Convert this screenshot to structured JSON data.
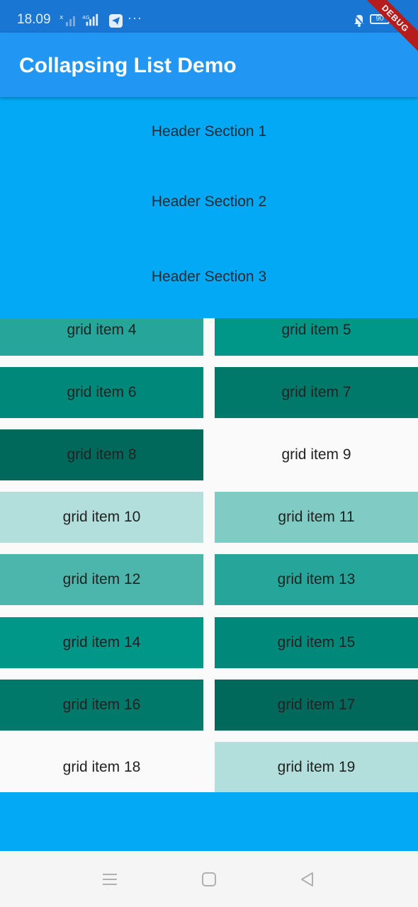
{
  "status_bar": {
    "time": "18.09",
    "battery": "90",
    "more": "···",
    "icons": [
      "signal-x-icon",
      "signal-4g-icon",
      "telegram-icon",
      "bell-off-icon",
      "battery-icon",
      "charging-icon"
    ]
  },
  "debug_banner": "DEBUG",
  "app_bar": {
    "title": "Collapsing List Demo"
  },
  "headers": [
    {
      "label": "Header Section 1"
    },
    {
      "label": "Header Section 2"
    },
    {
      "label": "Header Section 3"
    }
  ],
  "grid": {
    "items": [
      {
        "label": "grid item 4",
        "color": "#26a69a"
      },
      {
        "label": "grid item 5",
        "color": "#009688"
      },
      {
        "label": "grid item 6",
        "color": "#00897b"
      },
      {
        "label": "grid item 7",
        "color": "#00796b"
      },
      {
        "label": "grid item 8",
        "color": "#00695c"
      },
      {
        "label": "grid item 9",
        "color": "#fafafa"
      },
      {
        "label": "grid item 10",
        "color": "#b2dfdb"
      },
      {
        "label": "grid item 11",
        "color": "#80cbc4"
      },
      {
        "label": "grid item 12",
        "color": "#4db6ac"
      },
      {
        "label": "grid item 13",
        "color": "#26a69a"
      },
      {
        "label": "grid item 14",
        "color": "#009688"
      },
      {
        "label": "grid item 15",
        "color": "#00897b"
      },
      {
        "label": "grid item 16",
        "color": "#00796b"
      },
      {
        "label": "grid item 17",
        "color": "#00695c"
      },
      {
        "label": "grid item 18",
        "color": "#fafafa"
      },
      {
        "label": "grid item 19",
        "color": "#b2dfdb"
      }
    ]
  },
  "nav_bar": {
    "buttons": [
      "menu-icon",
      "home-icon",
      "back-icon"
    ]
  }
}
